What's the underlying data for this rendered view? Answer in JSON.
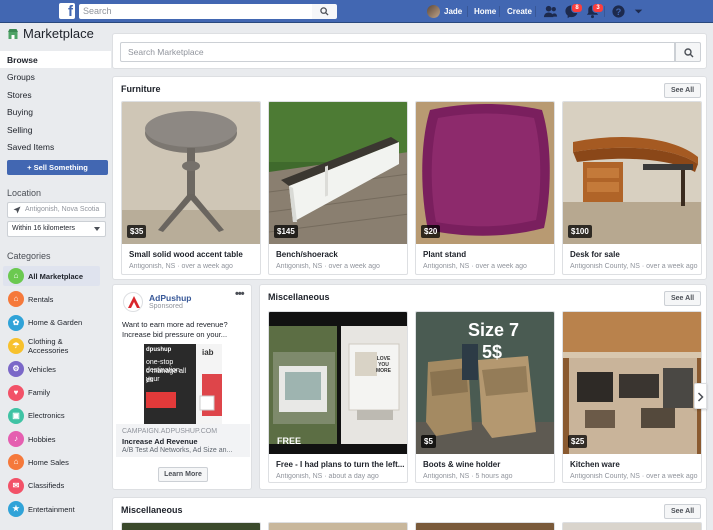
{
  "topbar": {
    "search_placeholder": "Search",
    "user": "Jade",
    "home": "Home",
    "create": "Create",
    "messages_badge": "8",
    "notifications_badge": "3",
    "brand_color": "#4267b2"
  },
  "sidebar": {
    "title": "Marketplace",
    "links": [
      "Browse",
      "Groups",
      "Stores",
      "Buying",
      "Selling",
      "Saved Items"
    ],
    "sell_button": "+ Sell Something",
    "location_heading": "Location",
    "location_value": "Antigonish, Nova Scotia",
    "distance_value": "Within 16 kilometers",
    "categories_heading": "Categories",
    "categories": [
      {
        "label": "All Marketplace",
        "icon": "store-icon",
        "color": "#6bc950"
      },
      {
        "label": "Rentals",
        "icon": "house-icon",
        "color": "#f5793b"
      },
      {
        "label": "Home & Garden",
        "icon": "home-garden-icon",
        "color": "#30a3d8"
      },
      {
        "label": "Clothing & Accessories",
        "icon": "shirt-icon",
        "color": "#f7c12d"
      },
      {
        "label": "Vehicles",
        "icon": "car-icon",
        "color": "#7b68c8"
      },
      {
        "label": "Family",
        "icon": "heart-icon",
        "color": "#f25268"
      },
      {
        "label": "Electronics",
        "icon": "device-icon",
        "color": "#3fc3a4"
      },
      {
        "label": "Hobbies",
        "icon": "guitar-icon",
        "color": "#e55fb0"
      },
      {
        "label": "Home Sales",
        "icon": "house-sale-icon",
        "color": "#f5793b"
      },
      {
        "label": "Classifieds",
        "icon": "gift-icon",
        "color": "#f25268"
      },
      {
        "label": "Entertainment",
        "icon": "ticket-icon",
        "color": "#30a3d8"
      }
    ]
  },
  "main_search": {
    "placeholder": "Search Marketplace"
  },
  "sections": [
    {
      "title": "Furniture",
      "see_all": "See All",
      "items": [
        {
          "price": "$35",
          "title": "Small solid wood accent table",
          "location": "Antigonish, NS",
          "time": "over a week ago"
        },
        {
          "price": "$145",
          "title": "Bench/shoerack",
          "location": "Antigonish, NS",
          "time": "over a week ago"
        },
        {
          "price": "$20",
          "title": "Plant stand",
          "location": "Antigonish, NS",
          "time": "over a week ago"
        },
        {
          "price": "$100",
          "title": "Desk for sale",
          "location": "Antigonish County, NS",
          "time": "over a week ago"
        }
      ]
    },
    {
      "title": "Miscellaneous",
      "see_all": "See All",
      "items": [
        {
          "price": "FREE",
          "title": "Free - I had plans to turn the left...",
          "location": "Antigonish, NS",
          "time": "about a day ago",
          "img_text": ""
        },
        {
          "price": "$5",
          "title": "Boots & wine holder",
          "location": "Antigonish, NS",
          "time": "5 hours ago",
          "img_text_1": "Size 7",
          "img_text_2": "5$"
        },
        {
          "price": "$25",
          "title": "Kitchen ware",
          "location": "Antigonish County, NS",
          "time": "over a week ago"
        }
      ]
    },
    {
      "title": "Miscellaneous",
      "see_all": "See All"
    }
  ],
  "ad": {
    "name": "AdPushup",
    "sponsored": "Sponsored",
    "text": "Want to earn more ad revenue? Increase bid pressure on your...",
    "url": "CAMPAIGN.ADPUSHUP.COM",
    "headline": "Increase Ad Revenue",
    "description": "A/B Test Ad Networks, Ad Size an...",
    "button": "Learn More",
    "img_line_1": "dpushup",
    "img_line_2": "one-stop destination",
    "img_line_3": "o manage all your",
    "img_line_4": "ds",
    "img_tag": "iab"
  },
  "misc_sign": {
    "l1": "LOVE",
    "l2": "YOU",
    "l3": "MORE"
  }
}
